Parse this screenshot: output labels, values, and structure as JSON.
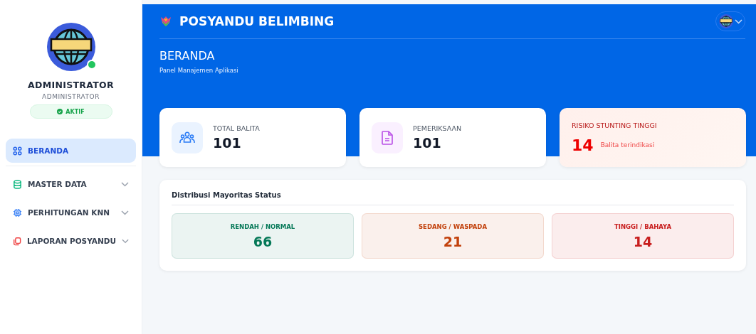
{
  "profile": {
    "name": "ADMINISTRATOR",
    "role": "ADMINISTRATOR",
    "status": "AKTIF",
    "online": true
  },
  "menu": [
    {
      "label": "BERANDA",
      "selected": true,
      "expandable": false
    },
    {
      "label": "MASTER DATA",
      "selected": false,
      "expandable": true
    },
    {
      "label": "PERHITUNGAN KNN",
      "selected": false,
      "expandable": true
    },
    {
      "label": "LAPORAN POSYANDU",
      "selected": false,
      "expandable": true
    }
  ],
  "header": {
    "app_title": "POSYANDU BELIMBING",
    "page_title": "BERANDA",
    "page_subtitle": "Panel Manajemen Aplikasi"
  },
  "stats": [
    {
      "kind": "normal",
      "label": "TOTAL BALITA",
      "value": "101"
    },
    {
      "kind": "normal",
      "label": "PEMERIKSAAN",
      "value": "101"
    },
    {
      "kind": "alert",
      "label": "RISIKO STUNTING TINGGI",
      "value": "14",
      "note": "Balita terindikasi"
    }
  ],
  "distribution": {
    "title": "Distribusi Mayoritas Status",
    "items": [
      {
        "label": "RENDAH / NORMAL",
        "value": "66",
        "color": "#047857"
      },
      {
        "label": "SEDANG / WASPADA",
        "value": "21",
        "color": "#c2410c"
      },
      {
        "label": "TINGGI / BAHAYA",
        "value": "14",
        "color": "#c81e1e"
      }
    ]
  }
}
